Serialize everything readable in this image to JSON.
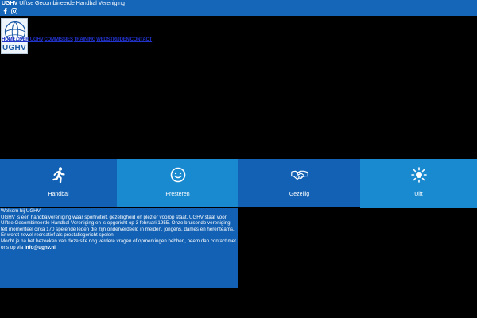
{
  "topbar": {
    "brand": "UGHV",
    "subtitle": "Ulftse Gecombineerde Handbal Vereniging",
    "social": [
      "facebook-icon",
      "instagram-icon"
    ]
  },
  "logo": {
    "text": "UGHV"
  },
  "nav": {
    "items": [
      "HOME",
      "OVER UGHV",
      "COMMISSIES",
      "TRAINING",
      "WEDSTRIJDEN",
      "CONTACT"
    ]
  },
  "features": [
    {
      "label": "Handbal",
      "icon": "running-person-icon"
    },
    {
      "label": "Presteren",
      "icon": "smiley-icon"
    },
    {
      "label": "Gezellig",
      "icon": "handshake-icon"
    },
    {
      "label": "Ulft",
      "icon": "sun-icon"
    }
  ],
  "welcome": {
    "heading": "Welkom bij UGHV",
    "body": "UGHV is een handbalvereniging waar sportiviteit, gezelligheid en plezier voorop staat. UGHV staat voor Ulftse Gecombineerde Handbal Vereniging en is opgericht op 3 februari 1955. Onze bruisende vereniging telt momenteel circa 170 spelende leden die zijn onderverdeeld in meiden, jongens, dames en herenteams. Er wordt zowel recreatief als prestatiegericht spelen.",
    "contact_text": "Mocht je na het bezoeken van deze site nog verdere vragen of opmerkingen hebben, neem dan contact met ons op via ",
    "contact_email": "info@ughv.nl"
  },
  "colors": {
    "primary": "#1261b4",
    "secondary": "#1a8ad0",
    "background": "#000000",
    "nav_link": "#2233cc"
  }
}
